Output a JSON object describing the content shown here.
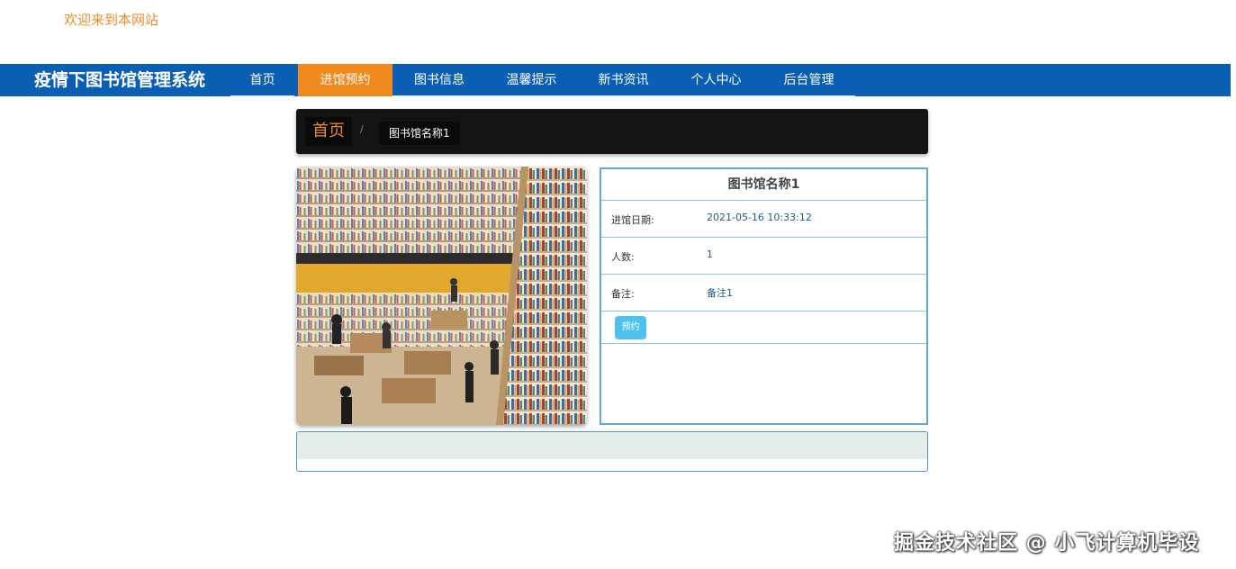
{
  "header": {
    "welcome": "欢迎来到本网站"
  },
  "navbar": {
    "brand": "疫情下图书馆管理系统",
    "items": [
      {
        "label": "首页"
      },
      {
        "label": "进馆预约",
        "active": true
      },
      {
        "label": "图书信息"
      },
      {
        "label": "温馨提示"
      },
      {
        "label": "新书资讯"
      },
      {
        "label": "个人中心"
      },
      {
        "label": "后台管理"
      }
    ]
  },
  "breadcrumb": {
    "home": "首页",
    "separator": "/",
    "current": "图书馆名称1"
  },
  "detail": {
    "title": "图书馆名称1",
    "rows": [
      {
        "label": "进馆日期:",
        "value": "2021-05-16 10:33:12"
      },
      {
        "label": "人数:",
        "value": "1"
      },
      {
        "label": "备注:",
        "value": "备注1"
      }
    ],
    "reserve_button": "预约"
  },
  "watermark": "掘金技术社区 @ 小飞计算机毕设",
  "colors": {
    "nav_bg": "#0a5fb4",
    "accent": "#f18a1c",
    "welcome": "#e88c2d",
    "button": "#4dc2ee"
  }
}
